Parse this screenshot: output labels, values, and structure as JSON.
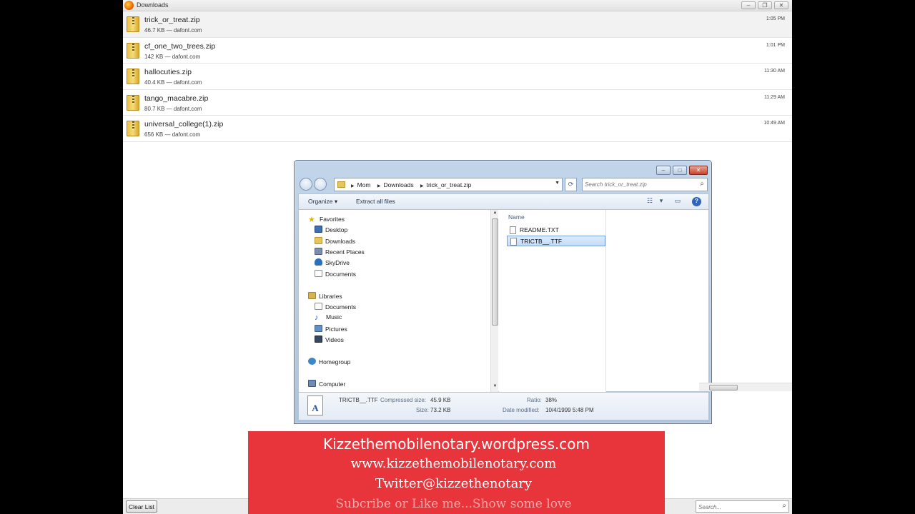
{
  "downloads_window": {
    "title": "Downloads",
    "items": [
      {
        "name": "trick_or_treat.zip",
        "info": "46.7 KB — dafont.com",
        "time": "1:05 PM"
      },
      {
        "name": "cf_one_two_trees.zip",
        "info": "142 KB — dafont.com",
        "time": "1:01 PM"
      },
      {
        "name": "hallocuties.zip",
        "info": "40.4 KB — dafont.com",
        "time": "11:30 AM"
      },
      {
        "name": "tango_macabre.zip",
        "info": "80.7 KB — dafont.com",
        "time": "11:29 AM"
      },
      {
        "name": "universal_college(1).zip",
        "info": "656 KB — dafont.com",
        "time": "10:49 AM"
      }
    ],
    "clear_list_label": "Clear List",
    "search_placeholder": "Search..."
  },
  "explorer": {
    "breadcrumb": [
      "Mom",
      "Downloads",
      "trick_or_treat.zip"
    ],
    "search_placeholder": "Search trick_or_treat.zip",
    "toolbar": {
      "organize": "Organize",
      "extract": "Extract all files"
    },
    "nav": {
      "favorites": "Favorites",
      "desktop": "Desktop",
      "downloads": "Downloads",
      "recent": "Recent Places",
      "skydrive": "SkyDrive",
      "documents": "Documents",
      "libraries": "Libraries",
      "lib_documents": "Documents",
      "music": "Music",
      "pictures": "Pictures",
      "videos": "Videos",
      "homegroup": "Homegroup",
      "computer": "Computer"
    },
    "column_header": "Name",
    "files": [
      {
        "name": "README.TXT"
      },
      {
        "name": "TRICTB__.TTF"
      }
    ],
    "details": {
      "file_name": "TRICTB__.TTF",
      "compressed_label": "Compressed size:",
      "compressed_value": "45.9 KB",
      "size_label": "Size:",
      "size_value": "73.2 KB",
      "ratio_label": "Ratio:",
      "ratio_value": "38%",
      "modified_label": "Date modified:",
      "modified_value": "10/4/1999 5:48 PM"
    }
  },
  "banner": {
    "line1": "Kizzethemobilenotary.wordpress.com",
    "line2": "www.kizzethemobilenotary.com",
    "line3": "Twitter@kizzethenotary",
    "line4": "Subcribe or Like me...Show some love"
  },
  "colors": {
    "banner": "#e8353c",
    "selection": "#c1dcfc"
  }
}
